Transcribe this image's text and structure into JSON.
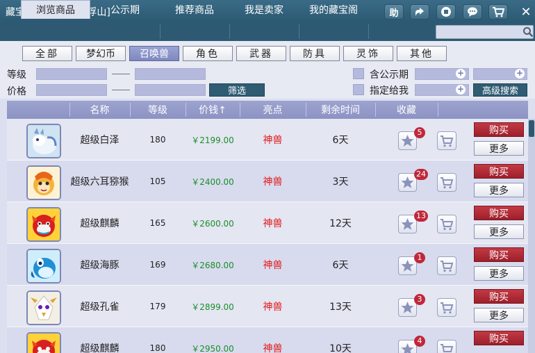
{
  "window": {
    "title": "藏宝阁-广东3区[罗浮山]",
    "help_label": "助"
  },
  "tabs": [
    {
      "label": "浏览商品"
    },
    {
      "label": "公示期"
    },
    {
      "label": "推荐商品"
    },
    {
      "label": "我是卖家"
    },
    {
      "label": "我的藏宝阁"
    }
  ],
  "search": {
    "value": ""
  },
  "categories": [
    {
      "label": "全部"
    },
    {
      "label": "梦幻币"
    },
    {
      "label": "召唤兽"
    },
    {
      "label": "角色"
    },
    {
      "label": "武器"
    },
    {
      "label": "防具"
    },
    {
      "label": "灵饰"
    },
    {
      "label": "其他"
    }
  ],
  "filters": {
    "level_label": "等级",
    "price_label": "价格",
    "filter_button": "筛选",
    "public_label": "含公示期",
    "assigned_label": "指定给我",
    "advanced_button": "高级搜索"
  },
  "table": {
    "headers": [
      "名称",
      "等级",
      "价钱↑",
      "亮点",
      "剩余时间",
      "收藏"
    ],
    "buy_label": "购买",
    "more_label": "更多",
    "rows": [
      {
        "name": "超级白泽",
        "level": "180",
        "price": "￥2199.00",
        "highlight": "神兽",
        "time": "6天",
        "favorites": "5",
        "avatar": "white-beast-avatar"
      },
      {
        "name": "超级六耳猕猴",
        "level": "105",
        "price": "￥2400.00",
        "highlight": "神兽",
        "time": "3天",
        "favorites": "24",
        "avatar": "monkey-avatar"
      },
      {
        "name": "超级麒麟",
        "level": "165",
        "price": "￥2600.00",
        "highlight": "神兽",
        "time": "12天",
        "favorites": "13",
        "avatar": "qilin-avatar"
      },
      {
        "name": "超级海豚",
        "level": "169",
        "price": "￥2680.00",
        "highlight": "神兽",
        "time": "6天",
        "favorites": "1",
        "avatar": "dolphin-avatar"
      },
      {
        "name": "超级孔雀",
        "level": "179",
        "price": "￥2899.00",
        "highlight": "神兽",
        "time": "13天",
        "favorites": "3",
        "avatar": "peacock-avatar"
      },
      {
        "name": "超级麒麟",
        "level": "180",
        "price": "￥2950.00",
        "highlight": "神兽",
        "time": "10天",
        "favorites": "4",
        "avatar": "qilin-avatar"
      }
    ]
  },
  "colors": {
    "titlebar": "#2c5972",
    "header": "#8c93c3",
    "price": "#1a8d2a",
    "highlight": "#e21b1b",
    "buy": "#9d1f2b"
  }
}
